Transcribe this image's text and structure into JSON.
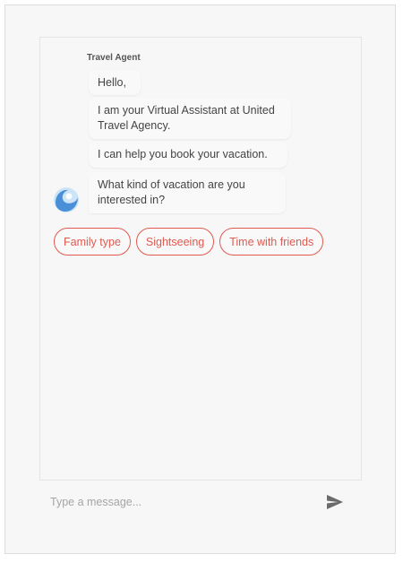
{
  "chat": {
    "sender_name": "Travel Agent",
    "messages": [
      {
        "text": "Hello,"
      },
      {
        "text": "I am your Virtual Assistant at United Travel Agency."
      },
      {
        "text": "I can help you book your vacation."
      },
      {
        "text": "What kind of vacation are you interested in?"
      }
    ],
    "quick_replies": [
      "Family type",
      "Sightseeing",
      "Time with friends"
    ],
    "avatar_icon": "wave-logo-icon"
  },
  "composer": {
    "placeholder": "Type a message...",
    "value": "",
    "send_icon": "send-icon"
  },
  "colors": {
    "accent": "#e05a4f",
    "avatar_blue": "#4a90d9",
    "avatar_light": "#cde4f7"
  }
}
